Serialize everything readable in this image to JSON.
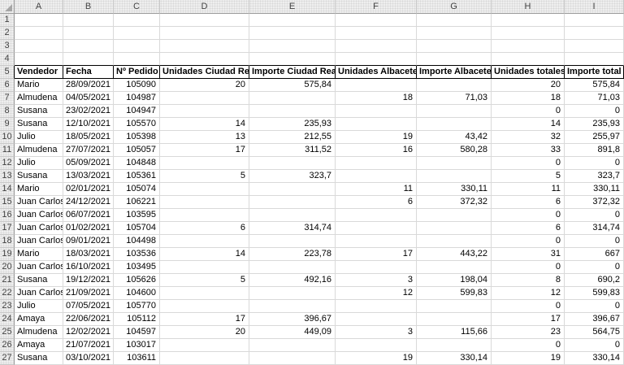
{
  "spreadsheet": {
    "column_letters": [
      "A",
      "B",
      "C",
      "D",
      "E",
      "F",
      "G",
      "H",
      "I"
    ],
    "row_numbers": [
      1,
      2,
      3,
      4,
      5,
      6,
      7,
      8,
      9,
      10,
      11,
      12,
      13,
      14,
      15,
      16,
      17,
      18,
      19,
      20,
      21,
      22,
      23,
      24,
      25,
      26,
      27
    ],
    "header_row_number": 5,
    "column_headers": [
      "Vendedor",
      "Fecha",
      "Nº Pedido",
      "Unidades Ciudad Real",
      "Importe Ciudad Real",
      "Unidades Albacete",
      "Importe Albacete",
      "Unidades totales",
      "Importe total"
    ],
    "data_rows": [
      {
        "row": 6,
        "cells": [
          "Mario",
          "28/09/2021",
          "105090",
          "20",
          "575,84",
          "",
          "",
          "20",
          "575,84"
        ]
      },
      {
        "row": 7,
        "cells": [
          "Almudena",
          "04/05/2021",
          "104987",
          "",
          "",
          "18",
          "71,03",
          "18",
          "71,03"
        ]
      },
      {
        "row": 8,
        "cells": [
          "Susana",
          "23/02/2021",
          "104947",
          "",
          "",
          "",
          "",
          "0",
          "0"
        ]
      },
      {
        "row": 9,
        "cells": [
          "Susana",
          "12/10/2021",
          "105570",
          "14",
          "235,93",
          "",
          "",
          "14",
          "235,93"
        ]
      },
      {
        "row": 10,
        "cells": [
          "Julio",
          "18/05/2021",
          "105398",
          "13",
          "212,55",
          "19",
          "43,42",
          "32",
          "255,97"
        ]
      },
      {
        "row": 11,
        "cells": [
          "Almudena",
          "27/07/2021",
          "105057",
          "17",
          "311,52",
          "16",
          "580,28",
          "33",
          "891,8"
        ]
      },
      {
        "row": 12,
        "cells": [
          "Julio",
          "05/09/2021",
          "104848",
          "",
          "",
          "",
          "",
          "0",
          "0"
        ]
      },
      {
        "row": 13,
        "cells": [
          "Susana",
          "13/03/2021",
          "105361",
          "5",
          "323,7",
          "",
          "",
          "5",
          "323,7"
        ]
      },
      {
        "row": 14,
        "cells": [
          "Mario",
          "02/01/2021",
          "105074",
          "",
          "",
          "11",
          "330,11",
          "11",
          "330,11"
        ]
      },
      {
        "row": 15,
        "cells": [
          "Juan Carlos",
          "24/12/2021",
          "106221",
          "",
          "",
          "6",
          "372,32",
          "6",
          "372,32"
        ]
      },
      {
        "row": 16,
        "cells": [
          "Juan Carlos",
          "06/07/2021",
          "103595",
          "",
          "",
          "",
          "",
          "0",
          "0"
        ]
      },
      {
        "row": 17,
        "cells": [
          "Juan Carlos",
          "01/02/2021",
          "105704",
          "6",
          "314,74",
          "",
          "",
          "6",
          "314,74"
        ]
      },
      {
        "row": 18,
        "cells": [
          "Juan Carlos",
          "09/01/2021",
          "104498",
          "",
          "",
          "",
          "",
          "0",
          "0"
        ]
      },
      {
        "row": 19,
        "cells": [
          "Mario",
          "18/03/2021",
          "103536",
          "14",
          "223,78",
          "17",
          "443,22",
          "31",
          "667"
        ]
      },
      {
        "row": 20,
        "cells": [
          "Juan Carlos",
          "16/10/2021",
          "103495",
          "",
          "",
          "",
          "",
          "0",
          "0"
        ]
      },
      {
        "row": 21,
        "cells": [
          "Susana",
          "19/12/2021",
          "105626",
          "5",
          "492,16",
          "3",
          "198,04",
          "8",
          "690,2"
        ]
      },
      {
        "row": 22,
        "cells": [
          "Juan Carlos",
          "21/09/2021",
          "104600",
          "",
          "",
          "12",
          "599,83",
          "12",
          "599,83"
        ]
      },
      {
        "row": 23,
        "cells": [
          "Julio",
          "07/05/2021",
          "105770",
          "",
          "",
          "",
          "",
          "0",
          "0"
        ]
      },
      {
        "row": 24,
        "cells": [
          "Amaya",
          "22/06/2021",
          "105112",
          "17",
          "396,67",
          "",
          "",
          "17",
          "396,67"
        ]
      },
      {
        "row": 25,
        "cells": [
          "Almudena",
          "12/02/2021",
          "104597",
          "20",
          "449,09",
          "3",
          "115,66",
          "23",
          "564,75"
        ]
      },
      {
        "row": 26,
        "cells": [
          "Amaya",
          "21/07/2021",
          "103017",
          "",
          "",
          "",
          "",
          "0",
          "0"
        ]
      },
      {
        "row": 27,
        "cells": [
          "Susana",
          "03/10/2021",
          "103611",
          "",
          "",
          "19",
          "330,14",
          "19",
          "330,14"
        ]
      }
    ],
    "colors": {
      "header_strip_bg": "#efefef",
      "header_strip_text": "#424242",
      "gridline": "#d9d9d9",
      "strip_border": "#9b9b9b",
      "table_header_border": "#000000",
      "cell_text": "#000000",
      "select_all_triangle": "#a6a6a6"
    }
  }
}
